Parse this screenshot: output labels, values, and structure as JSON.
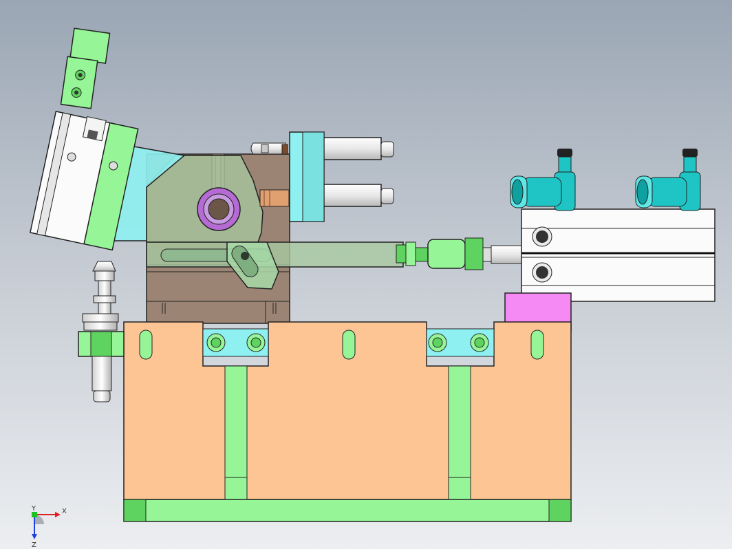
{
  "viewport": {
    "background_top": "#9aa6b4",
    "background_bottom": "#eceef1"
  },
  "colors": {
    "base_block": "#fdc594",
    "rail": "#96f596",
    "rail_dark": "#5fd35f",
    "cyan_part": "#8ef0f0",
    "bronze_plate": "#9b8474",
    "pink_block": "#f68af4",
    "cylinder_white": "#fbfbfb",
    "fitting_teal": "#1fc4c4",
    "bushing_purple": "#b56ad4",
    "outline": "#111111"
  },
  "triad": {
    "x_label": "X",
    "y_label": "Y",
    "z_label": "Z",
    "icon": "coordinate-triad-icon"
  }
}
